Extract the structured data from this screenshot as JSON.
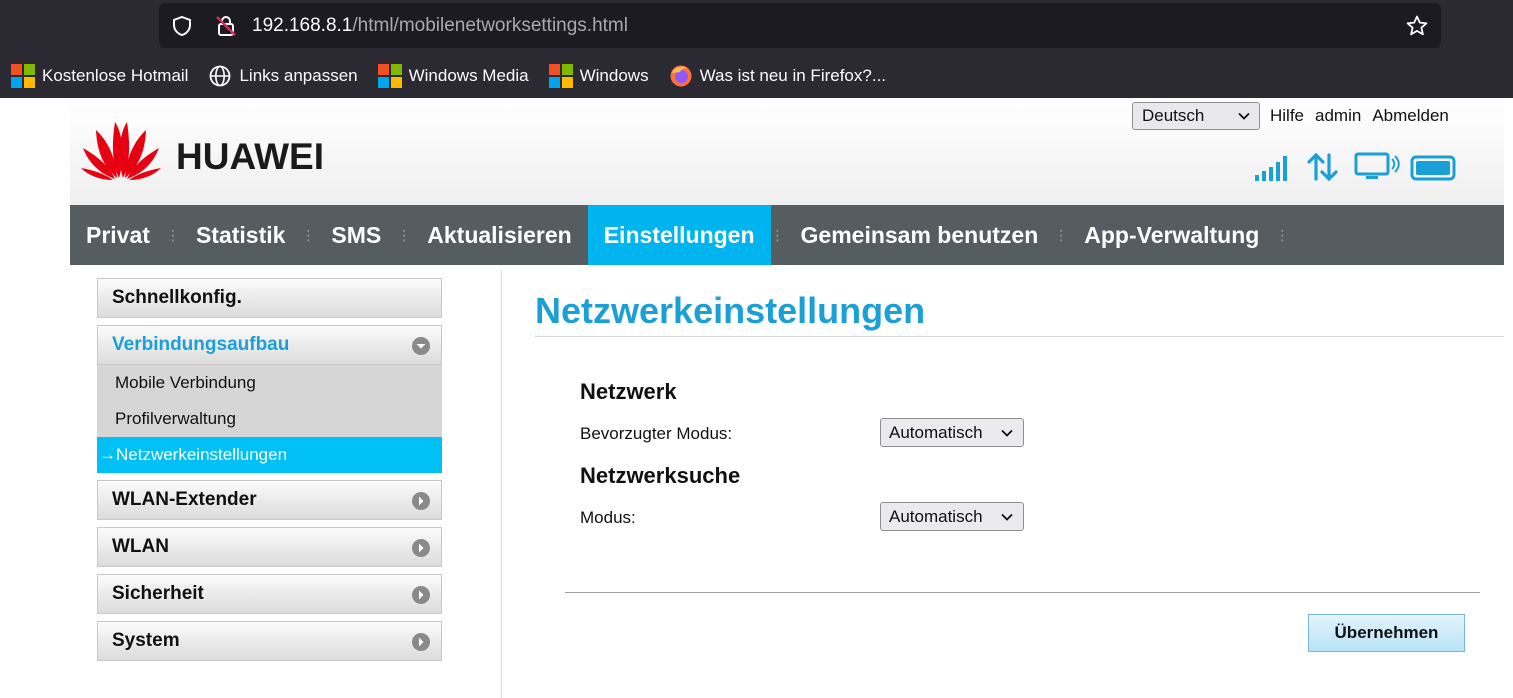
{
  "browser": {
    "url_host": "192.168.8.1",
    "url_path": "/html/mobilenetworksettings.html",
    "bookmarks": [
      {
        "label": "Kostenlose Hotmail",
        "icon": "microsoft-icon"
      },
      {
        "label": "Links anpassen",
        "icon": "globe-icon"
      },
      {
        "label": "Windows Media",
        "icon": "microsoft-icon"
      },
      {
        "label": "Windows",
        "icon": "microsoft-icon"
      },
      {
        "label": "Was ist neu in Firefox?...",
        "icon": "firefox-icon"
      }
    ]
  },
  "header": {
    "brand": "HUAWEI",
    "language": "Deutsch",
    "links": {
      "help": "Hilfe",
      "user": "admin",
      "logout": "Abmelden"
    },
    "colors": {
      "brand_red": "#e60012",
      "accent": "#00b4f0",
      "status_icons": "#1a9fd6"
    }
  },
  "nav": {
    "items": [
      {
        "label": "Privat",
        "active": false
      },
      {
        "label": "Statistik",
        "active": false
      },
      {
        "label": "SMS",
        "active": false
      },
      {
        "label": "Aktualisieren",
        "active": false
      },
      {
        "label": "Einstellungen",
        "active": true
      },
      {
        "label": "Gemeinsam benutzen",
        "active": false
      },
      {
        "label": "App-Verwaltung",
        "active": false
      }
    ]
  },
  "sidebar": {
    "quick_setup": "Schnellkonfig.",
    "connection": {
      "label": "Verbindungsaufbau",
      "items": [
        "Mobile Verbindung",
        "Profilverwaltung",
        "Netzwerkeinstellungen"
      ],
      "active_arrow": "→"
    },
    "wlan_extender": "WLAN-Extender",
    "wlan": "WLAN",
    "security": "Sicherheit",
    "system": "System"
  },
  "main": {
    "title": "Netzwerkeinstellungen",
    "network": {
      "heading": "Netzwerk",
      "preferred_mode_label": "Bevorzugter Modus:",
      "preferred_mode_value": "Automatisch"
    },
    "search": {
      "heading": "Netzwerksuche",
      "mode_label": "Modus:",
      "mode_value": "Automatisch"
    },
    "apply_button": "Übernehmen"
  }
}
